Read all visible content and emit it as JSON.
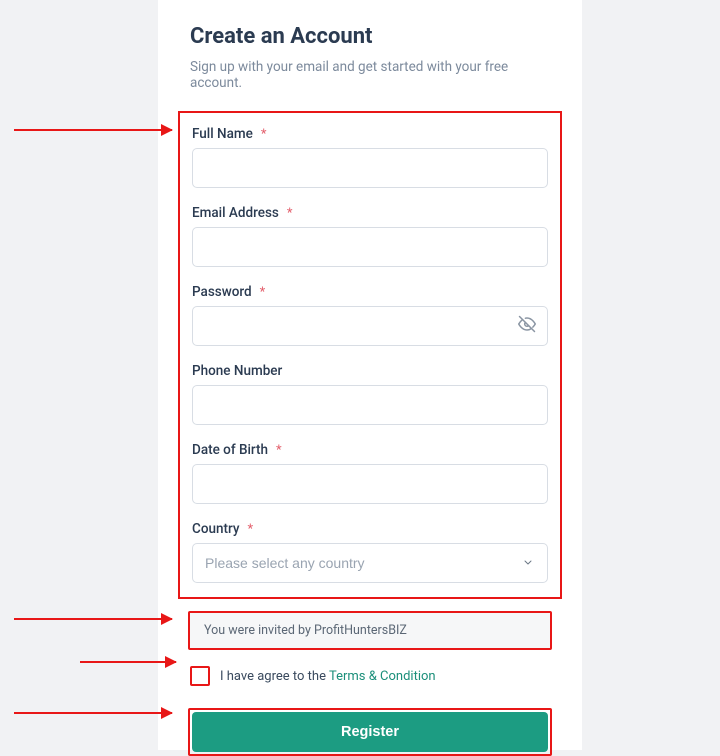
{
  "header": {
    "title": "Create an Account",
    "subtitle": "Sign up with your email and get started with your free account."
  },
  "fields": {
    "fullname_label": "Full Name",
    "email_label": "Email Address",
    "password_label": "Password",
    "phone_label": "Phone Number",
    "dob_label": "Date of Birth",
    "country_label": "Country",
    "country_placeholder": "Please select any country",
    "required_mark": "*"
  },
  "invite": {
    "text": "You were invited by ProfitHuntersBIZ"
  },
  "terms": {
    "prefix": "I have agree to the ",
    "link": "Terms & Condition"
  },
  "actions": {
    "register": "Register"
  }
}
